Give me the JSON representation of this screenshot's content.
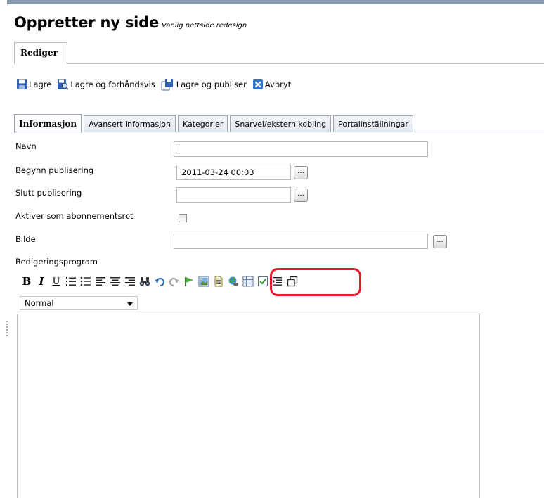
{
  "header": {
    "title": "Oppretter ny side",
    "subtitle": "Vanlig nettside redesign"
  },
  "top_tab": {
    "label": "Rediger"
  },
  "toolbar": {
    "save": "Lagre",
    "save_preview": "Lagre og forhåndsvis",
    "save_publish": "Lagre og publiser",
    "cancel": "Avbryt"
  },
  "tabs": [
    {
      "label": "Informasjon",
      "active": true
    },
    {
      "label": "Avansert informasjon",
      "active": false
    },
    {
      "label": "Kategorier",
      "active": false
    },
    {
      "label": "Snarvei/ekstern kobling",
      "active": false
    },
    {
      "label": "Portalinställningar",
      "active": false
    }
  ],
  "form": {
    "name_label": "Navn",
    "name_value": "",
    "start_label": "Begynn publisering",
    "start_value": "2011-03-24 00:03",
    "end_label": "Slutt publisering",
    "end_value": "",
    "subscription_label": "Aktiver som abonnementsrot",
    "subscription_checked": false,
    "image_label": "Bilde",
    "image_value": "",
    "editor_label": "Redigeringsprogram",
    "browse_label": "..."
  },
  "editor": {
    "bold": "B",
    "italic": "I",
    "underline": "U",
    "format_value": "Normal",
    "content": ""
  },
  "colors": {
    "highlight": "#e8192c",
    "tab_border": "#9aa6b6",
    "topbar": "#8a98ae"
  }
}
